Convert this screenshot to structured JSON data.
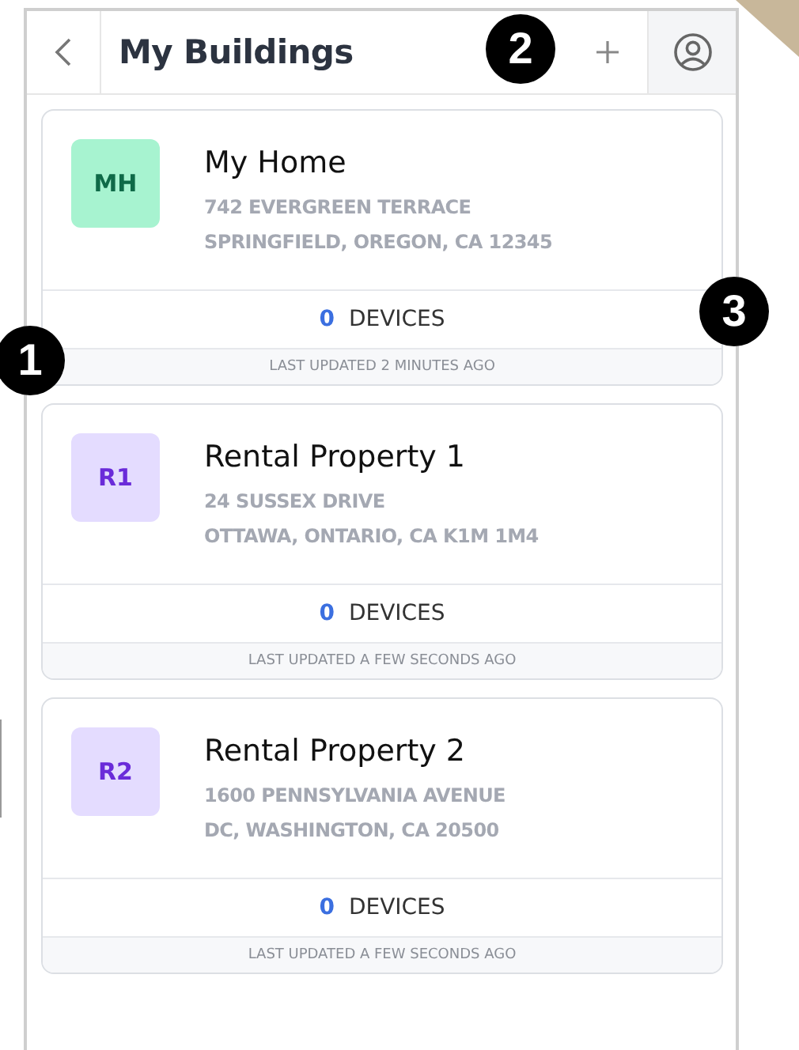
{
  "header": {
    "title": "My Buildings"
  },
  "buildings": [
    {
      "initials": "MH",
      "color": "#a7f3d0",
      "name": "My Home",
      "address_line_1": "742 EVERGREEN TERRACE",
      "address_line_2": "SPRINGFIELD, OREGON, CA 12345",
      "device_count": "0",
      "devices_label": "DEVICES",
      "updated": "LAST UPDATED 2 MINUTES AGO"
    },
    {
      "initials": "R1",
      "color": "#e4dcff",
      "name": "Rental Property 1",
      "address_line_1": "24 SUSSEX DRIVE",
      "address_line_2": "OTTAWA, ONTARIO, CA K1M 1M4",
      "device_count": "0",
      "devices_label": "DEVICES",
      "updated": "LAST UPDATED A FEW SECONDS AGO"
    },
    {
      "initials": "R2",
      "color": "#e4dcff",
      "name": "Rental Property 2",
      "address_line_1": "1600 PENNSYLVANIA AVENUE",
      "address_line_2": "DC, WASHINGTON, CA 20500",
      "device_count": "0",
      "devices_label": "DEVICES",
      "updated": "LAST UPDATED A FEW SECONDS AGO"
    }
  ],
  "callouts": [
    "1",
    "2",
    "3"
  ]
}
